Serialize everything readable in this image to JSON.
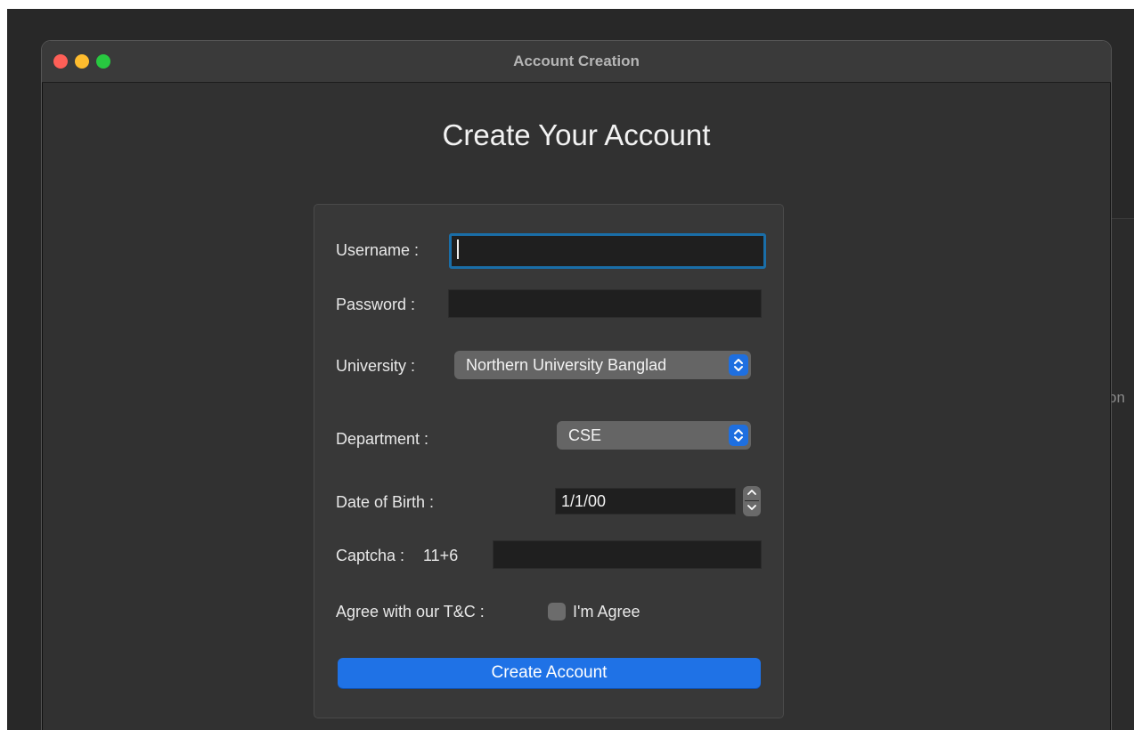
{
  "window": {
    "title": "Account Creation",
    "background_text": "on"
  },
  "form": {
    "heading": "Create Your Account",
    "username": {
      "label": "Username :",
      "value": ""
    },
    "password": {
      "label": "Password :",
      "value": ""
    },
    "university": {
      "label": "University :",
      "selected": "Northern University Banglad"
    },
    "department": {
      "label": "Department :",
      "selected": "CSE"
    },
    "date_of_birth": {
      "label": "Date of Birth :",
      "value": "1/1/00"
    },
    "captcha": {
      "label": "Captcha :",
      "challenge": "11+6",
      "value": ""
    },
    "terms": {
      "label": "Agree with our T&C :",
      "checkbox_label": "I'm Agree",
      "checked": false
    },
    "submit_label": "Create Account"
  },
  "icons": {
    "popup_arrows": "chevron-up-down-icon",
    "stepper_up": "chevron-up-icon",
    "stepper_down": "chevron-down-icon"
  },
  "colors": {
    "accent": "#1f72e6",
    "focus_ring": "#1a6ea8",
    "close": "#fe5f57",
    "minimize": "#febc2e",
    "maximize": "#28c840"
  }
}
